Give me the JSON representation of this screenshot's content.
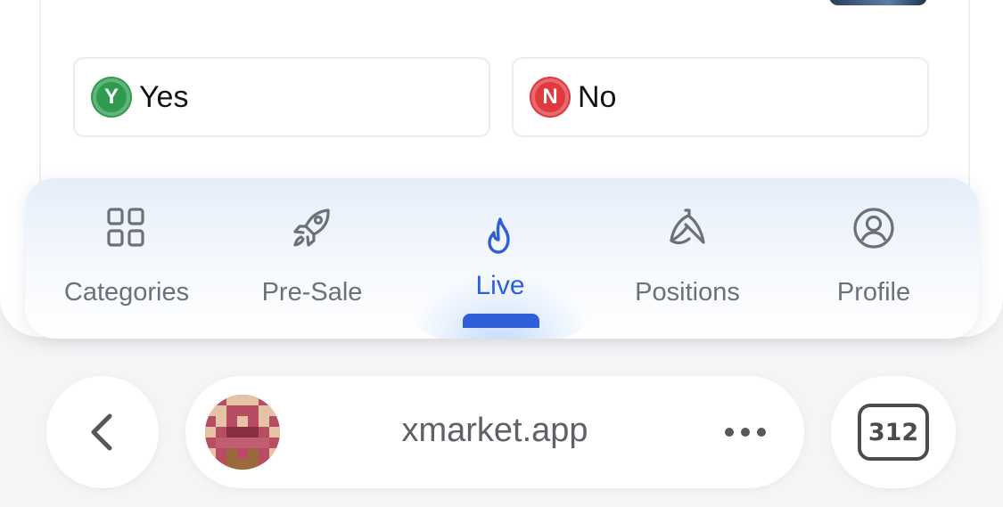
{
  "market": {
    "outcomes": [
      {
        "badge": "Y",
        "label": "Yes",
        "color": "#2f9b4f"
      },
      {
        "badge": "N",
        "label": "No",
        "color": "#e0393e"
      }
    ]
  },
  "tabbar": {
    "active": "Live",
    "accent_color": "#2e5fd8",
    "items": [
      {
        "label": "Categories",
        "icon": "grid-icon"
      },
      {
        "label": "Pre-Sale",
        "icon": "rocket-icon"
      },
      {
        "label": "Live",
        "icon": "flame-icon"
      },
      {
        "label": "Positions",
        "icon": "banana-icon"
      },
      {
        "label": "Profile",
        "icon": "user-circle-icon"
      }
    ]
  },
  "browser": {
    "back_icon": "chevron-left-icon",
    "url": "xmarket.app",
    "more_icon": "ellipsis-icon",
    "tab_count": "312"
  }
}
